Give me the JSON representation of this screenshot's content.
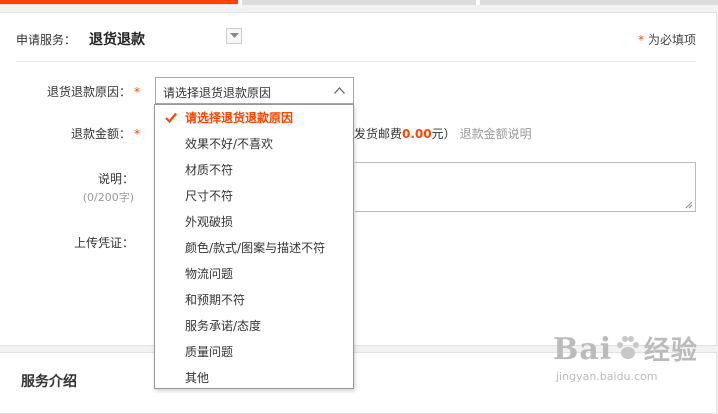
{
  "header": {
    "label": "申请服务：",
    "value": "退货退款",
    "required_note": "为必填项",
    "required_mark": "*"
  },
  "form": {
    "reason_label": "退货退款原因：",
    "reason_placeholder": "请选择退货退款原因",
    "amount_label": "退款金额：",
    "fee_prefix": "发货邮费",
    "fee_value": "0.00",
    "fee_suffix": "元）",
    "fee_link": "退款金额说明",
    "desc_label": "说明：",
    "desc_counter": "(0/200字)",
    "upload_label": "上传凭证："
  },
  "dropdown": {
    "options": [
      "请选择退货退款原因",
      "效果不好/不喜欢",
      "材质不符",
      "尺寸不符",
      "外观破损",
      "颜色/款式/图案与描述不符",
      "物流问题",
      "和预期不符",
      "服务承诺/态度",
      "质量问题",
      "其他"
    ],
    "selected_index": 0
  },
  "service": {
    "title": "服务介绍"
  },
  "watermark": {
    "brand": "Bai",
    "cn": "经验",
    "url": "jingyan.baidu.com"
  },
  "colors": {
    "accent": "#ff4400"
  }
}
